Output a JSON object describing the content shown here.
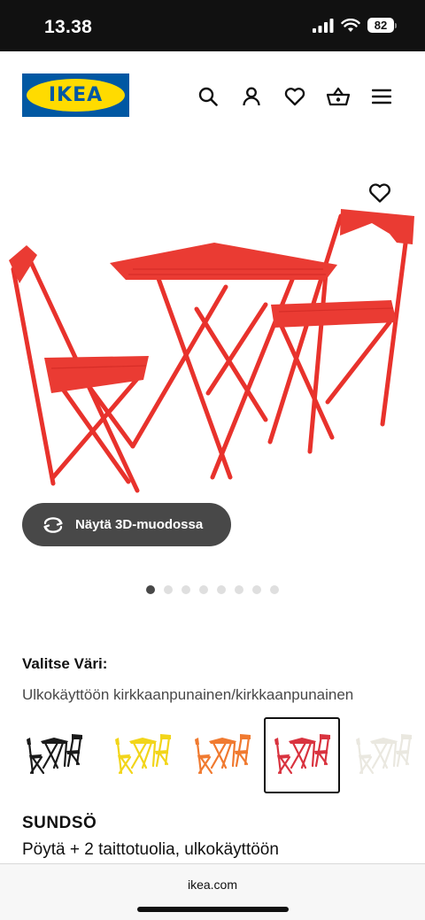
{
  "status_bar": {
    "time": "13.38",
    "battery": "82"
  },
  "header": {
    "logo_text": "IKEA",
    "icons": [
      "search-icon",
      "user-icon",
      "heart-icon",
      "basket-icon",
      "menu-icon"
    ]
  },
  "gallery": {
    "view_3d_label": "Näytä 3D-muodossa",
    "dots_total": 8,
    "dots_active_index": 0
  },
  "color_picker": {
    "heading": "Valitse Väri:",
    "selected_value": "Ulkokäyttöön kirkkaanpunainen/kirkkaanpunainen",
    "swatches": [
      {
        "color": "#1a1a1a",
        "selected": false
      },
      {
        "color": "#f2d51a",
        "selected": false
      },
      {
        "color": "#f07a30",
        "selected": false
      },
      {
        "color": "#d9333f",
        "selected": true
      },
      {
        "color": "#eae8e0",
        "selected": false
      }
    ]
  },
  "product": {
    "name": "SUNDSÖ",
    "description": "Pöytä + 2 taittotuolia, ulkokäyttöön"
  },
  "browser": {
    "url": "ikea.com"
  },
  "colors": {
    "product_red": "#ea3b33",
    "ikea_blue": "#0058a3",
    "ikea_yellow": "#ffdb00"
  }
}
